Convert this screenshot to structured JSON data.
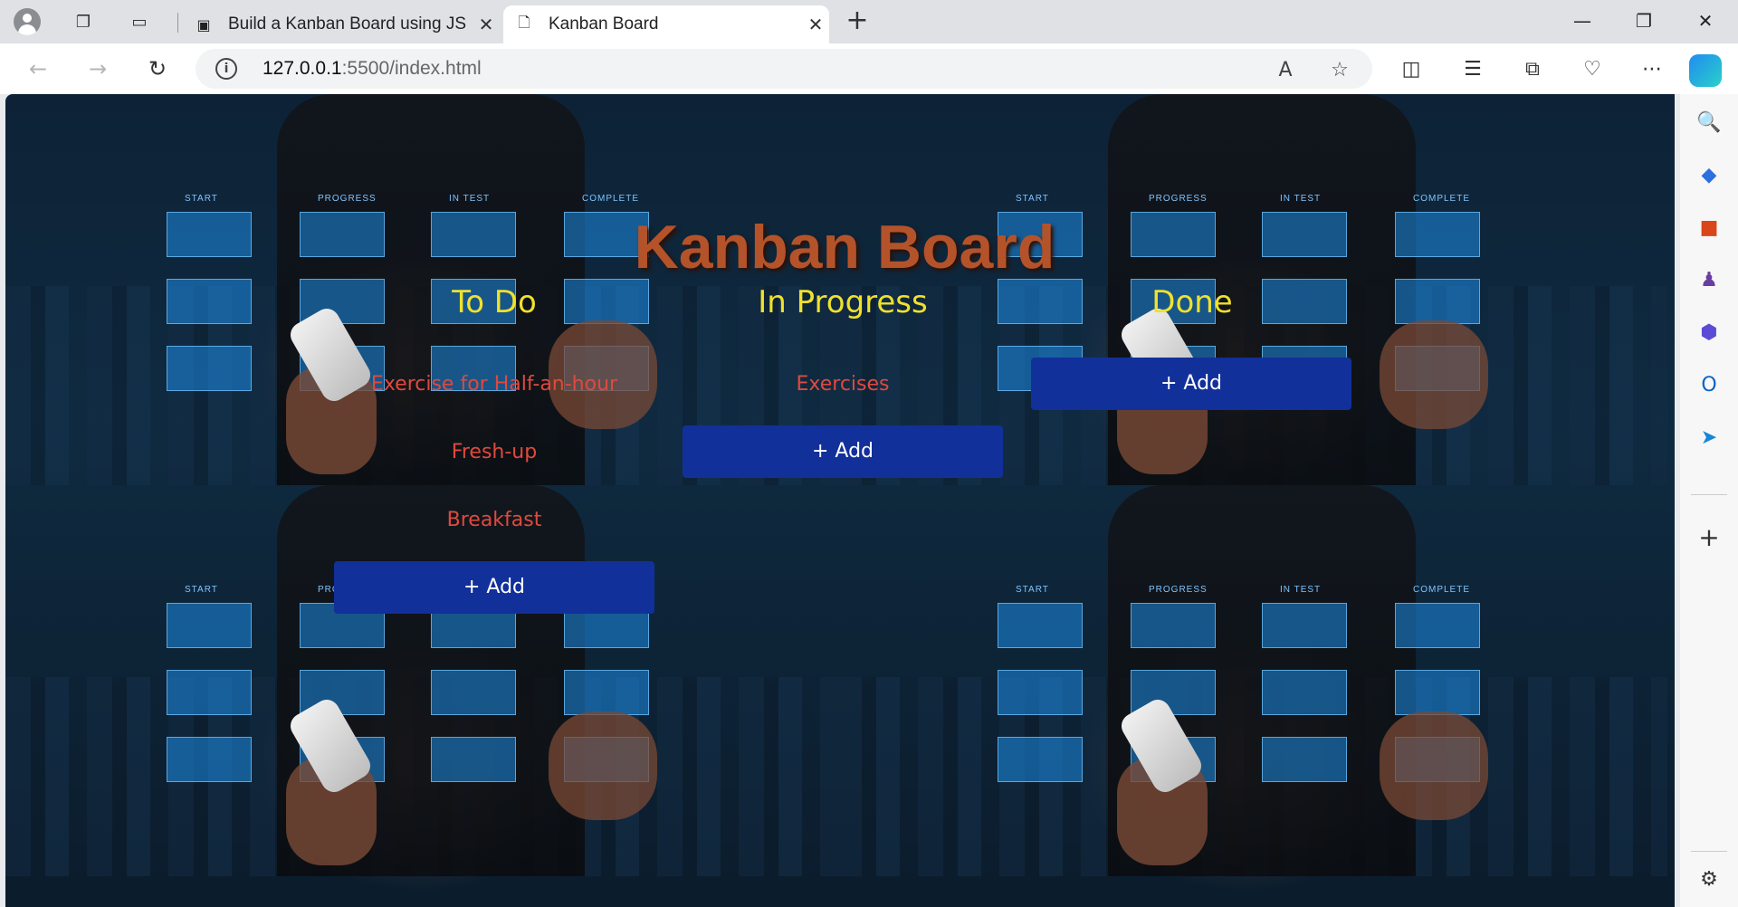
{
  "browser": {
    "tabs": [
      {
        "title": "Build a Kanban Board using JS",
        "favicon": "code-editor-icon"
      },
      {
        "title": "Kanban Board",
        "favicon": "page-icon"
      }
    ],
    "address": {
      "host": "127.0.0.1",
      "path": ":5500/index.html"
    }
  },
  "board": {
    "title": "Kanban Board",
    "columns": [
      {
        "title": "To Do",
        "tasks": [
          "Exercise for Half-an-hour",
          "Fresh-up",
          "Breakfast"
        ],
        "add_label": "+ Add"
      },
      {
        "title": "In Progress",
        "tasks": [
          "Exercises"
        ],
        "add_label": "+ Add"
      },
      {
        "title": "Done",
        "tasks": [],
        "add_label": "+ Add"
      }
    ]
  },
  "background_labels": [
    "START",
    "PROGRESS",
    "IN TEST",
    "COMPLETE"
  ],
  "colors": {
    "title": "#b4532a",
    "column_title": "#f0e12c",
    "task_text": "#e0493d",
    "add_button": "#12309a"
  }
}
